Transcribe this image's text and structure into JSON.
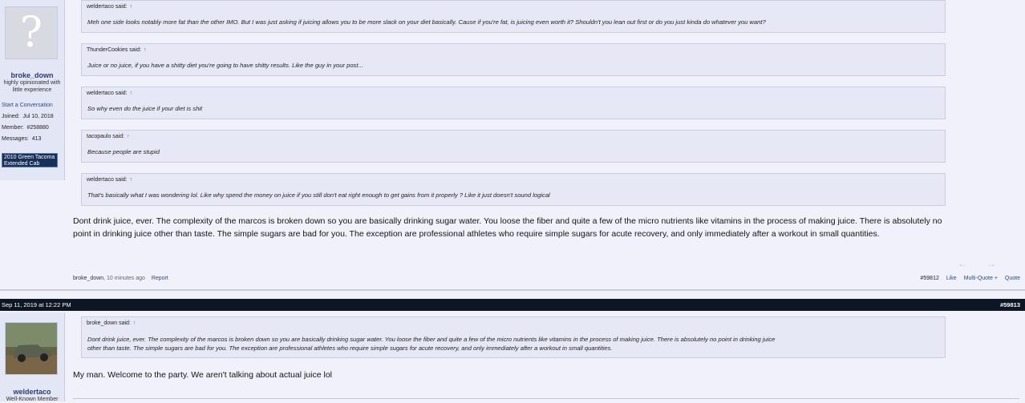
{
  "post1": {
    "user": {
      "name": "broke_down",
      "title": "highly opinionated with little experience",
      "start_conversation": "Start a Conversation",
      "joined_label": "Joined:",
      "joined": "Jul 10, 2018",
      "member_label": "Member:",
      "member": "#258880",
      "messages_label": "Messages:",
      "messages": "413",
      "badge": "2010 Green Tacoma Extended Cab"
    },
    "quotes": [
      {
        "author": "weldertaco said:",
        "arrow": "↑",
        "text": "Meh one side looks notably more fat than the other IMO. But I was just asking if juicing allows you to be more slack on your diet basically. Cause if you're fat, is juicing even worth it? Shouldn't you lean out first or do you just kinda do whatever you want?"
      },
      {
        "author": "ThunderCookies said:",
        "arrow": "↑",
        "text": "Juice or no juice, if you have a shitty diet you're going to have shitty results. Like the guy in your post..."
      },
      {
        "author": "weldertaco said:",
        "arrow": "↑",
        "text": "So why even do the juice if your diet is shit"
      },
      {
        "author": "tacopaulo said:",
        "arrow": "↑",
        "text": "Because people are stupid"
      },
      {
        "author": "weldertaco said:",
        "arrow": "↑",
        "text": "That's basically what I was wondering lol. Like why spend the money on juice if you still don't eat right enough to get gains from it properly ? Like it just doesn't sound logical"
      }
    ],
    "message_line1": "Dont drink juice, ever. The complexity of the marcos is broken down so you are basically drinking sugar water. You loose the fiber and quite a few of the micro nutrients like vitamins in the process of making juice. There is absolutely no",
    "message_line2": "point in drinking juice other than taste. The simple sugars are bad for you. The exception are professional athletes who require simple sugars for acute recovery, and only immediately after a workout in small quantities.",
    "footer": {
      "author": "broke_down",
      "time": ", 10 minutes ago",
      "report": "Report",
      "number": "#59812",
      "like": "Like",
      "multiquote": "Multi-Quote +",
      "quote": "Quote",
      "nav_prev": "←",
      "nav_next": "→"
    }
  },
  "post2": {
    "date": "Sep 11, 2019 at 12:22 PM",
    "number": "#59813",
    "user": {
      "name": "weldertaco",
      "title": "Well-Known Member"
    },
    "quote": {
      "author": "broke_down said:",
      "arrow": "↑",
      "text_line1": "Dont drink juice, ever. The complexity of the marcos is broken down so you are basically drinking sugar water. You loose the fiber and quite a few of the micro nutrients like vitamins in the process of making juice. There is absolutely no point in drinking juice",
      "text_line2": "other than taste. The simple sugars are bad for you. The exception are professional athletes who require simple sugars for acute recovery, and only immediately after a workout in small quantities."
    },
    "message": "My man. Welcome to the party. We aren't talking about actual juice lol"
  },
  "colors": {
    "background": "#f0f1fa",
    "userpane": "#e3e6f5",
    "postbar": "#0d1624",
    "link": "#2b4a8a",
    "badge": "#17305a"
  },
  "icons": {
    "avatar_placeholder": "question-mark-icon",
    "quote_arrow": "up-arrow-icon",
    "nav": "arrow-icons"
  }
}
